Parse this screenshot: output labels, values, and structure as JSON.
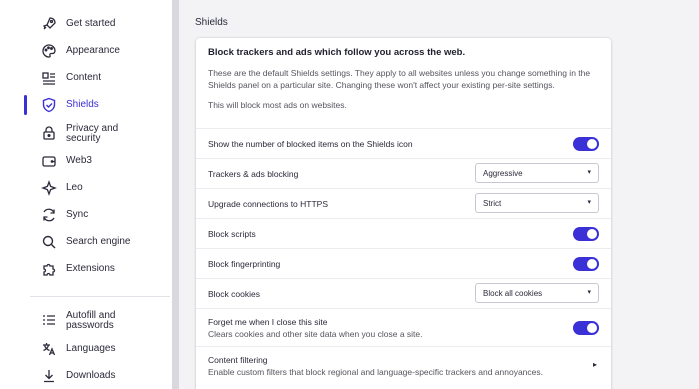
{
  "sidebar": {
    "items": [
      {
        "label": "Get started"
      },
      {
        "label": "Appearance"
      },
      {
        "label": "Content"
      },
      {
        "label": "Shields"
      },
      {
        "label_line1": "Privacy and",
        "label_line2": "security"
      },
      {
        "label": "Web3"
      },
      {
        "label": "Leo"
      },
      {
        "label": "Sync"
      },
      {
        "label": "Search engine"
      },
      {
        "label": "Extensions"
      },
      {
        "label_line1": "Autofill and",
        "label_line2": "passwords"
      },
      {
        "label": "Languages"
      },
      {
        "label": "Downloads"
      }
    ],
    "active_index": 3
  },
  "main": {
    "section_title": "Shields",
    "card": {
      "heading": "Block trackers and ads which follow you across the web.",
      "description": "These are the default Shields settings. They apply to all websites unless you change something in the Shields panel on a particular site. Changing these won't affect your existing per-site settings.",
      "note": "This will block most ads on websites.",
      "rows": {
        "show_count": {
          "label": "Show the number of blocked items on the Shields icon",
          "enabled": true
        },
        "trackers": {
          "label": "Trackers & ads blocking",
          "value": "Aggressive"
        },
        "https": {
          "label": "Upgrade connections to HTTPS",
          "value": "Strict"
        },
        "scripts": {
          "label": "Block scripts",
          "enabled": true
        },
        "fingerprinting": {
          "label": "Block fingerprinting",
          "enabled": true
        },
        "cookies": {
          "label": "Block cookies",
          "value": "Block all cookies"
        },
        "forget_me": {
          "label": "Forget me when I close this site",
          "sublabel": "Clears cookies and other site data when you close a site.",
          "enabled": true
        },
        "content_filtering": {
          "label": "Content filtering",
          "sublabel": "Enable custom filters that block regional and language-specific trackers and annoyances."
        }
      }
    }
  },
  "colors": {
    "accent": "#3b2fd6",
    "sidebar_bg": "#ffffff",
    "page_bg": "#f3f3f5"
  },
  "icons": [
    "rocket-icon",
    "palette-icon",
    "content-icon",
    "shield-icon",
    "lock-icon",
    "wallet-icon",
    "sparkle-icon",
    "sync-icon",
    "search-icon",
    "puzzle-icon",
    "list-key-icon",
    "translate-icon",
    "download-icon"
  ]
}
